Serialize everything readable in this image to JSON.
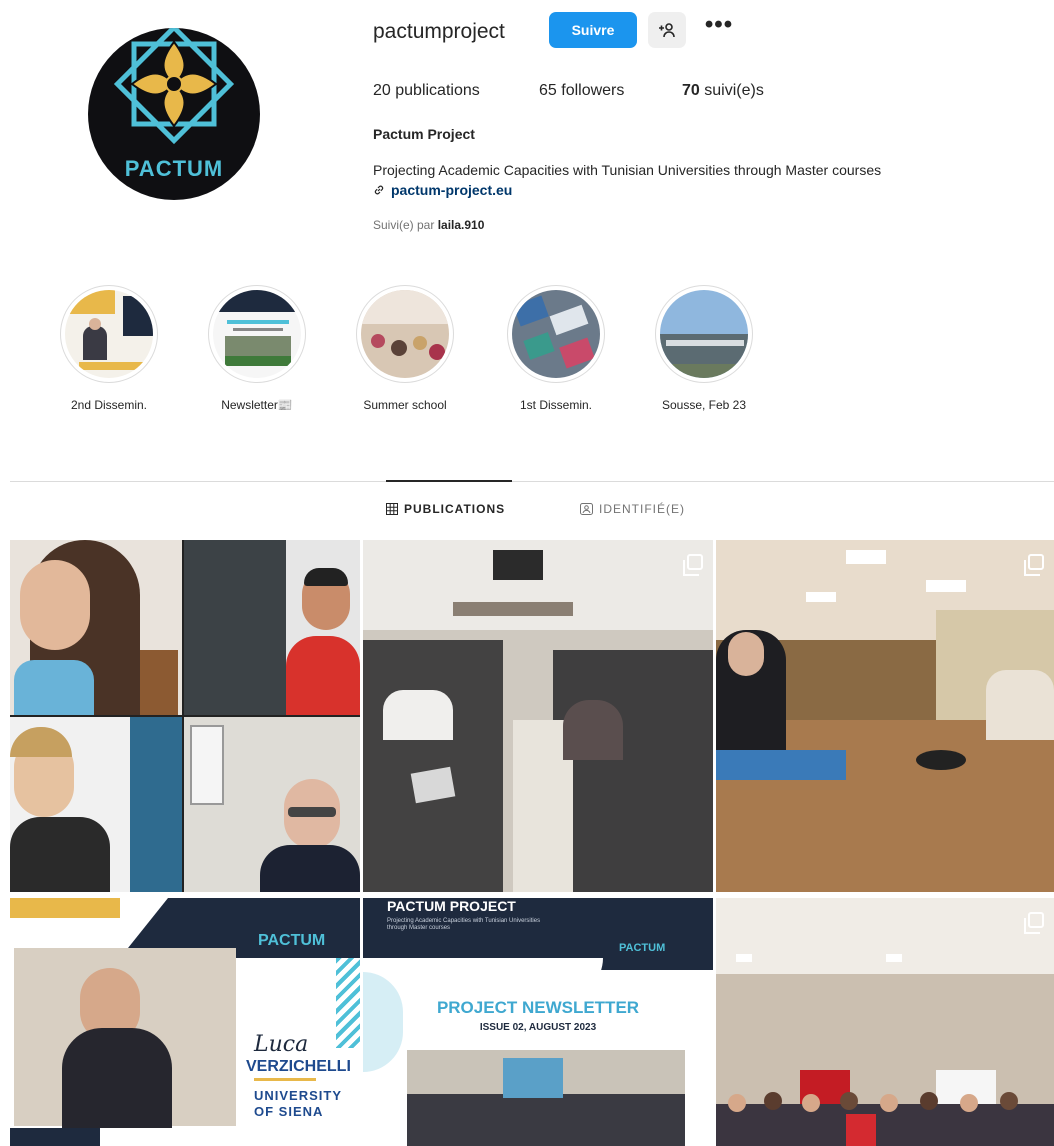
{
  "profile": {
    "username": "pactumproject",
    "follow_label": "Suivre",
    "add_person_glyph": "+&#x1F464;",
    "more_glyph": "•••",
    "avatar_text": "PACTUM",
    "stats": {
      "posts_count": "20",
      "posts_label": "publications",
      "followers_count": "65",
      "followers_label": "followers",
      "following_count": "70",
      "following_label": "suivi(e)s"
    },
    "full_name": "Pactum Project",
    "bio": "Projecting Academic Capacities with Tunisian Universities through Master courses",
    "link": "pactum-project.eu",
    "followed_by_prefix": "Suivi(e) par",
    "followed_by_user": "laila.910"
  },
  "highlights": [
    {
      "label": "2nd Dissemin.",
      "icon": "dissemination-thumbnail"
    },
    {
      "label": "Newsletter📰",
      "icon": "newsletter-thumbnail"
    },
    {
      "label": "Summer school",
      "icon": "classroom-thumbnail"
    },
    {
      "label": "1st Dissemin.",
      "icon": "workshop-thumbnail"
    },
    {
      "label": "Sousse, Feb 23",
      "icon": "building-thumbnail"
    }
  ],
  "tabs": {
    "posts_label": "PUBLICATIONS",
    "tagged_label": "IDENTIFIÉ(E)"
  },
  "posts": [
    {
      "kind": "video-call-collage",
      "multi": false
    },
    {
      "kind": "classroom-photo",
      "multi": true
    },
    {
      "kind": "meeting-room-photo",
      "multi": true
    },
    {
      "kind": "speaker-card",
      "multi": false,
      "brand": "PACTUM",
      "first_name": "Luca",
      "last_name": "VERZICHELLI",
      "affiliation_line1": "UNIVERSITY",
      "affiliation_line2": "OF SIENA"
    },
    {
      "kind": "newsletter-cover",
      "multi": false,
      "header": "PACTUM PROJECT",
      "subheader": "Projecting Academic Capacities with Tunisian Universities through Master courses",
      "brand": "PACTUM",
      "title": "PROJECT NEWSLETTER",
      "issue": "ISSUE 02, AUGUST 2023"
    },
    {
      "kind": "group-photo",
      "multi": true
    }
  ],
  "colors": {
    "follow_button": "#1b95ee",
    "link": "#00376b",
    "brand_teal": "#4fc0d8",
    "brand_gold": "#e8b84a",
    "brand_navy": "#1e2a3e"
  }
}
